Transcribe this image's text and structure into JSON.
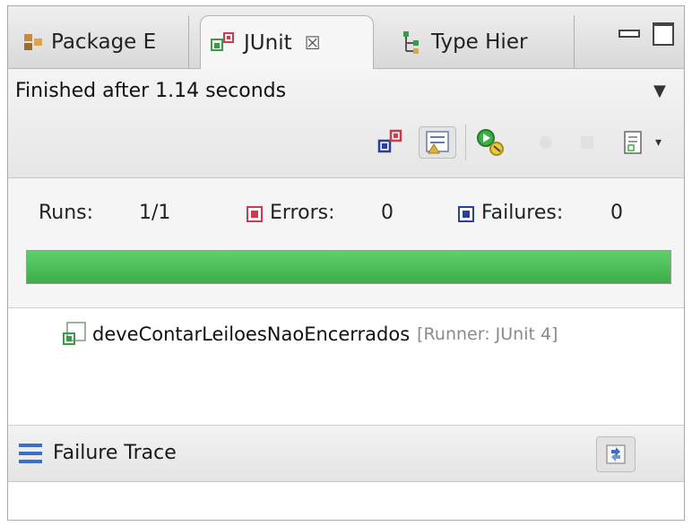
{
  "tabs": {
    "package_explorer": "Package E",
    "junit": "JUnit",
    "junit_close": "☒",
    "type_hierarchy": "Type Hier"
  },
  "status": {
    "finished": "Finished after 1.14 seconds",
    "view_menu": "▼"
  },
  "toolbar": {
    "dropdown": "▾"
  },
  "counters": {
    "runs_label": "Runs:",
    "runs_value": "1/1",
    "errors_label": "Errors:",
    "errors_value": "0",
    "failures_label": "Failures:",
    "failures_value": "0"
  },
  "progress": {
    "fraction": 1.0,
    "color": "#3cae47"
  },
  "tree": {
    "test_name": "deveContarLeiloesNaoEncerrados",
    "runner": "[Runner: JUnit 4]"
  },
  "failure_trace": {
    "title": "Failure Trace"
  },
  "colors": {
    "error": "#d23a4a",
    "failure": "#2b3f9a",
    "success": "#3cae47"
  },
  "icons": {
    "package_explorer": "package-explorer-icon",
    "junit": "junit-icon",
    "type_hierarchy": "type-hierarchy-icon",
    "next_failure": "next-failure-icon",
    "previous_failure": "previous-failure-icon",
    "rerun": "rerun-icon",
    "history": "test-history-icon",
    "failure_trace": "failure-trace-icon",
    "compare": "compare-results-icon"
  }
}
